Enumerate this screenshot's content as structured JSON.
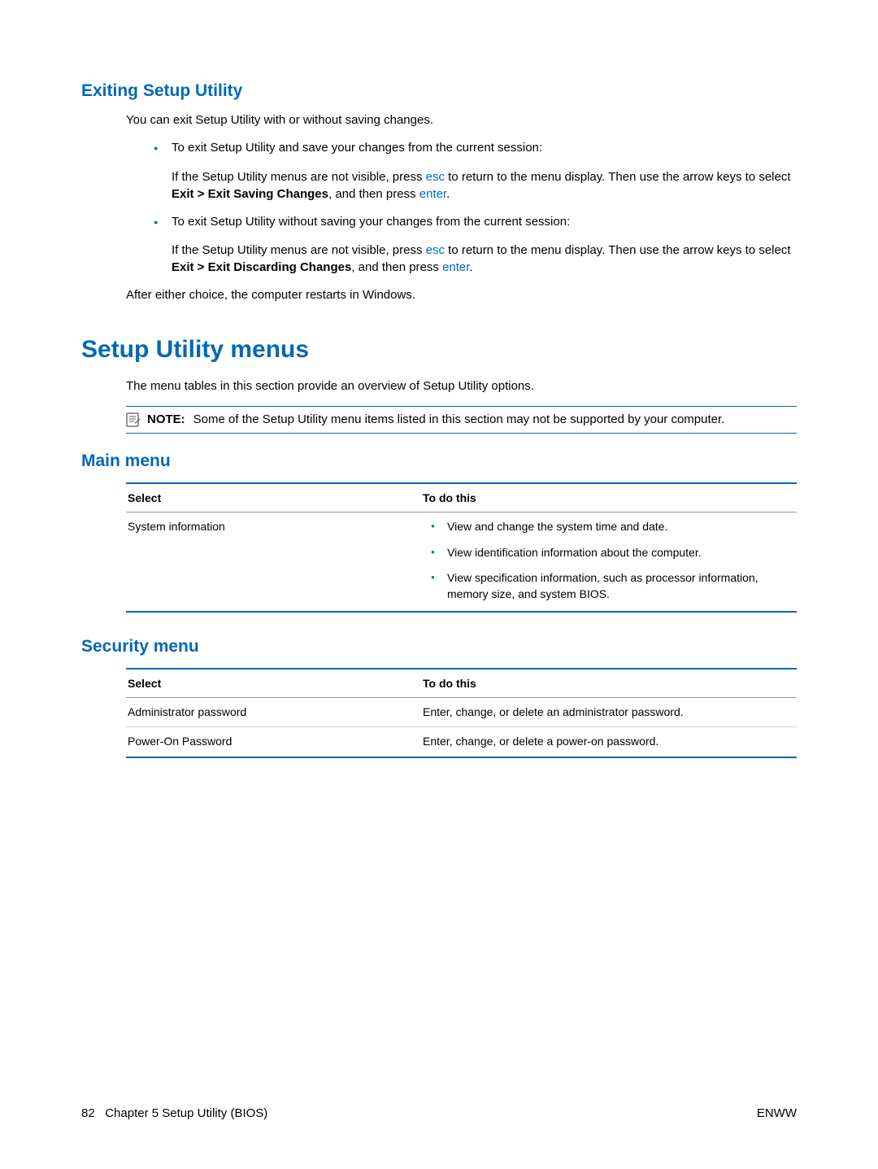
{
  "h_exit": "Exiting Setup Utility",
  "exit_intro": "You can exit Setup Utility with or without saving changes.",
  "exit_b1": "To exit Setup Utility and save your changes from the current session:",
  "exit_b1_sub_a": "If the Setup Utility menus are not visible, press ",
  "exit_b1_sub_b": " to return to the menu display. Then use the arrow keys to select ",
  "exit_b1_bold": "Exit > Exit Saving Changes",
  "exit_b1_sub_c": ", and then press ",
  "key_esc": "esc",
  "key_enter": "enter",
  "period": ".",
  "exit_b2": "To exit Setup Utility without saving your changes from the current session:",
  "exit_b2_sub_a": "If the Setup Utility menus are not visible, press ",
  "exit_b2_sub_b": " to return to the menu display. Then use the arrow keys to select ",
  "exit_b2_bold": "Exit > Exit Discarding Changes",
  "exit_b2_sub_c": ", and then press ",
  "exit_after": "After either choice, the computer restarts in Windows.",
  "h_menus": "Setup Utility menus",
  "menus_intro": "The menu tables in this section provide an overview of Setup Utility options.",
  "note_label": "NOTE:",
  "note_text": "Some of the Setup Utility menu items listed in this section may not be supported by your computer.",
  "h_main": "Main menu",
  "tbl_col_select": "Select",
  "tbl_col_todo": "To do this",
  "main_row_select": "System information",
  "main_cell_b1": "View and change the system time and date.",
  "main_cell_b2": "View identification information about the computer.",
  "main_cell_b3": "View specification information, such as processor information, memory size, and system BIOS.",
  "h_security": "Security menu",
  "sec_r1_select": "Administrator password",
  "sec_r1_todo": "Enter, change, or delete an administrator password.",
  "sec_r2_select": "Power-On Password",
  "sec_r2_todo": "Enter, change, or delete a power-on password.",
  "footer_page": "82",
  "footer_chapter": "Chapter 5   Setup Utility (BIOS)",
  "footer_right": "ENWW"
}
